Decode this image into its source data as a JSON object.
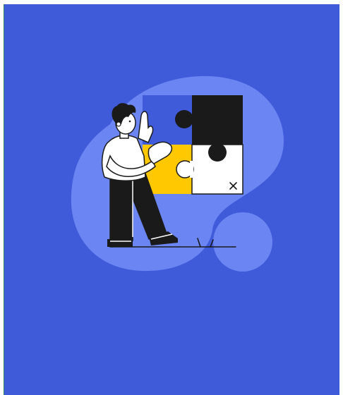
{
  "colors": {
    "page_background": "#ffffff",
    "panel_background": "#3f5bd9",
    "blob": "#6b86f3",
    "puzzle_blue": "#3f5bd9",
    "puzzle_black": "#1a1a1a",
    "puzzle_yellow": "#ffc800",
    "puzzle_white": "#ffffff",
    "outline": "#1a1a1a"
  },
  "illustration": {
    "subject": "person-assembling-puzzle",
    "icons": [
      "puzzle-icon",
      "close-x-icon",
      "person-figure"
    ]
  }
}
